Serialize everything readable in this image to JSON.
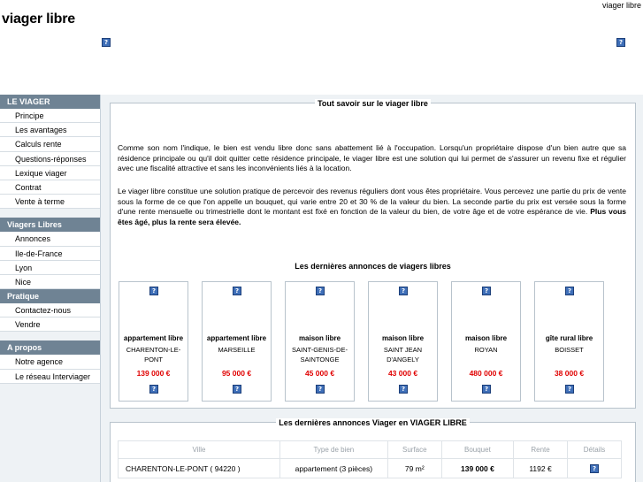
{
  "header": {
    "top_link": "viager libre",
    "logo": "viager libre"
  },
  "sidebar": {
    "sections": [
      {
        "title": "LE VIAGER",
        "items": [
          "Principe",
          "Les avantages",
          "Calculs rente",
          "Questions-réponses",
          "Lexique viager",
          "Contrat",
          "Vente à terme"
        ]
      },
      {
        "title": "Viagers Libres",
        "items": [
          "Annonces",
          "Ile-de-France",
          "Lyon",
          "Nice"
        ]
      },
      {
        "title": "Pratique",
        "items": [
          "Contactez-nous",
          "Vendre"
        ]
      },
      {
        "title": "A propos",
        "items": [
          "Notre agence",
          "Le réseau Interviager"
        ]
      }
    ]
  },
  "intro": {
    "legend": "Tout savoir sur le viager libre",
    "p1": "Comme son nom l'indique, le bien est vendu libre donc sans abattement lié à l'occupation. Lorsqu'un propriétaire dispose d'un bien autre que sa résidence principale ou qu'il doit quitter cette résidence principale, le viager libre est une solution qui lui permet de s'assurer un revenu fixe et régulier avec une fiscalité attractive et sans les inconvénients liés à la location.",
    "p2_text": "Le viager libre constitue une solution pratique de percevoir des revenus réguliers dont vous êtes propriétaire. Vous percevez une partie du prix de vente sous la forme de ce que l'on appelle un bouquet, qui varie entre 20 et 30 % de la valeur du bien. La seconde partie du prix est versée sous la forme d'une rente mensuelle ou trimestrielle dont le montant est fixé en fonction de la valeur du bien, de votre âge et de votre espérance de vie.",
    "p2_bold": "Plus vous êtes âgé, plus la rente sera élevée."
  },
  "annonces": {
    "title": "Les dernières annonces de viagers libres",
    "cards": [
      {
        "type": "appartement libre",
        "city": "CHARENTON-LE-PONT",
        "price": "139 000 €"
      },
      {
        "type": "appartement libre",
        "city": "MARSEILLE",
        "price": "95 000 €"
      },
      {
        "type": "maison libre",
        "city": "SAINT-GENIS-DE-SAINTONGE",
        "price": "45 000 €"
      },
      {
        "type": "maison libre",
        "city": "SAINT JEAN D'ANGELY",
        "price": "43 000 €"
      },
      {
        "type": "maison libre",
        "city": "ROYAN",
        "price": "480 000 €"
      },
      {
        "type": "gîte rural libre",
        "city": "BOISSET",
        "price": "38 000 €"
      }
    ]
  },
  "listing": {
    "legend": "Les dernières annonces Viager en VIAGER LIBRE",
    "headers": [
      "Ville",
      "Type de bien",
      "Surface",
      "Bouquet",
      "Rente",
      "Détails"
    ],
    "rows": [
      {
        "ville": "CHARENTON-LE-PONT ( 94220 )",
        "type": "appartement (3 pièces)",
        "surface": "79 m²",
        "bouquet": "139 000 €",
        "rente": "1192 €"
      }
    ]
  },
  "icons": {
    "placeholder": "question-mark-icon"
  }
}
